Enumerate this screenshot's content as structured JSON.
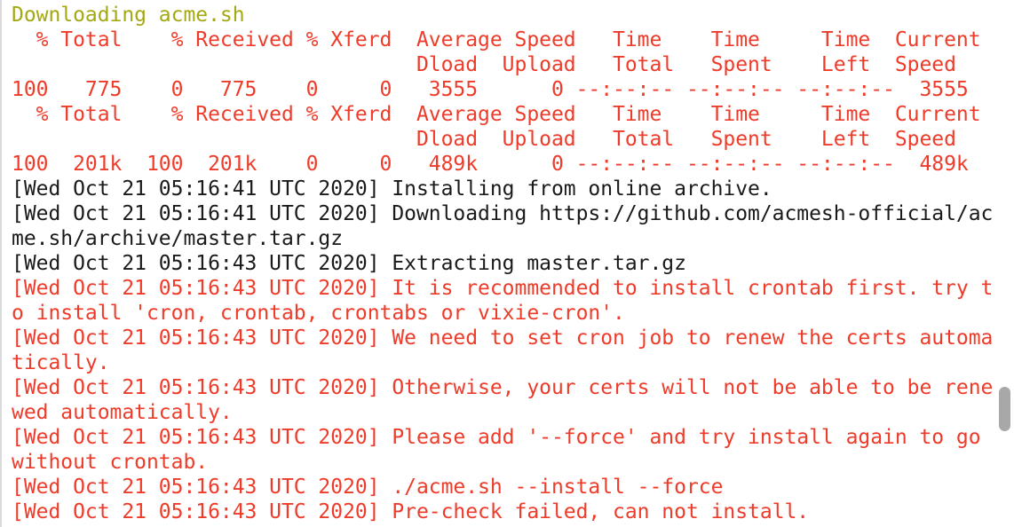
{
  "terminal": {
    "lines": [
      {
        "text": "Downloading acme.sh",
        "color": "#a3a912"
      },
      {
        "text": "  % Total    % Received % Xferd  Average Speed   Time    Time     Time  Current",
        "color": "#ee3b2a"
      },
      {
        "text": "                                 Dload  Upload   Total   Spent    Left  Speed",
        "color": "#ee3b2a"
      },
      {
        "text": "100   775    0   775    0     0   3555      0 --:--:-- --:--:-- --:--:--  3555",
        "color": "#ee3b2a"
      },
      {
        "text": "  % Total    % Received % Xferd  Average Speed   Time    Time     Time  Current",
        "color": "#ee3b2a"
      },
      {
        "text": "                                 Dload  Upload   Total   Spent    Left  Speed",
        "color": "#ee3b2a"
      },
      {
        "text": "100  201k  100  201k    0     0   489k      0 --:--:-- --:--:-- --:--:--  489k",
        "color": "#ee3b2a"
      },
      {
        "text": "[Wed Oct 21 05:16:41 UTC 2020] Installing from online archive.",
        "color": "#1a1a1a"
      },
      {
        "text": "[Wed Oct 21 05:16:41 UTC 2020] Downloading https://github.com/acmesh-official/ac",
        "color": "#1a1a1a"
      },
      {
        "text": "me.sh/archive/master.tar.gz",
        "color": "#1a1a1a"
      },
      {
        "text": "[Wed Oct 21 05:16:43 UTC 2020] Extracting master.tar.gz",
        "color": "#1a1a1a"
      },
      {
        "text": "[Wed Oct 21 05:16:43 UTC 2020] It is recommended to install crontab first. try t",
        "color": "#ee3b2a"
      },
      {
        "text": "o install 'cron, crontab, crontabs or vixie-cron'.",
        "color": "#ee3b2a"
      },
      {
        "text": "[Wed Oct 21 05:16:43 UTC 2020] We need to set cron job to renew the certs automa",
        "color": "#ee3b2a"
      },
      {
        "text": "tically.",
        "color": "#ee3b2a"
      },
      {
        "text": "[Wed Oct 21 05:16:43 UTC 2020] Otherwise, your certs will not be able to be rene",
        "color": "#ee3b2a"
      },
      {
        "text": "wed automatically.",
        "color": "#ee3b2a"
      },
      {
        "text": "[Wed Oct 21 05:16:43 UTC 2020] Please add '--force' and try install again to go",
        "color": "#ee3b2a"
      },
      {
        "text": "without crontab.",
        "color": "#ee3b2a"
      },
      {
        "text": "[Wed Oct 21 05:16:43 UTC 2020] ./acme.sh --install --force",
        "color": "#ee3b2a"
      },
      {
        "text": "[Wed Oct 21 05:16:43 UTC 2020] Pre-check failed, can not install.",
        "color": "#ee3b2a"
      }
    ]
  }
}
